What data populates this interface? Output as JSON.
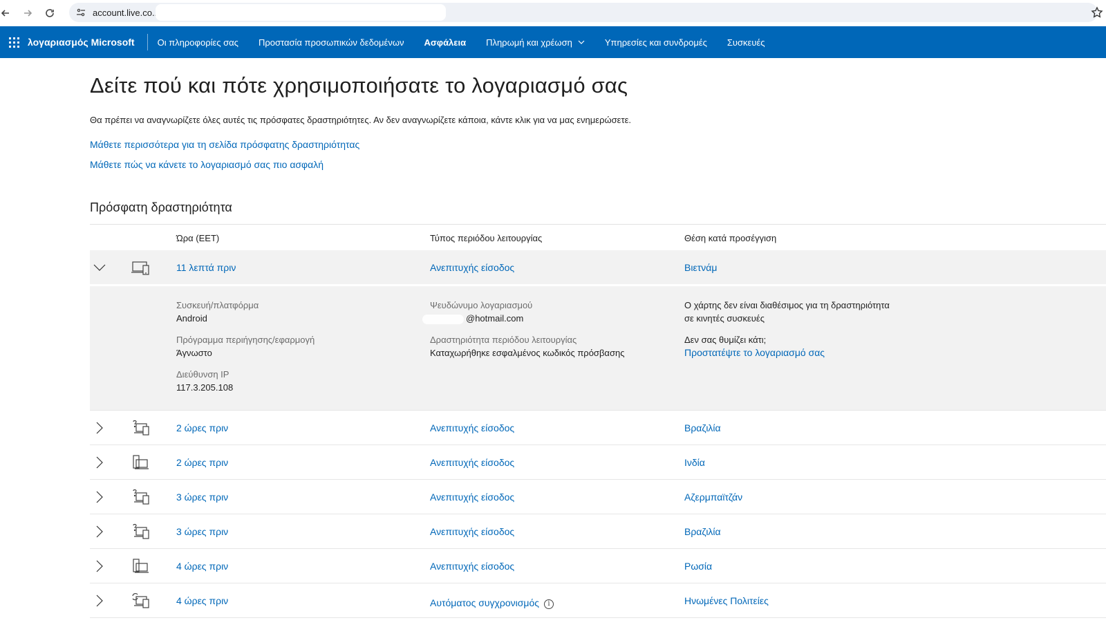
{
  "browser": {
    "url": "account.live.co.."
  },
  "nav": {
    "brand": "λογαριασμός Microsoft",
    "items": [
      {
        "label": "Οι πληροφορίες σας"
      },
      {
        "label": "Προστασία προσωπικών δεδομένων"
      },
      {
        "label": "Ασφάλεια",
        "active": true
      },
      {
        "label": "Πληρωμή και χρέωση",
        "dropdown": true
      },
      {
        "label": "Υπηρεσίες και συνδρομές"
      },
      {
        "label": "Συσκευές"
      }
    ],
    "color": "#0067b8"
  },
  "page": {
    "title": "Δείτε πού και πότε χρησιμοποιήσατε το λογαριασμό σας",
    "description": "Θα πρέπει να αναγνωρίζετε όλες αυτές τις πρόσφατες δραστηριότητες. Αν δεν αναγνωρίζετε κάποια, κάντε κλικ για να μας ενημερώσετε.",
    "link_learn_more": "Μάθετε περισσότερα για τη σελίδα πρόσφατης δραστηριότητας",
    "link_secure": "Μάθετε πώς να κάνετε το λογαριασμό σας πιο ασφαλή",
    "section_title": "Πρόσφατη δραστηριότητα"
  },
  "table": {
    "headers": {
      "time": "Ώρα (EET)",
      "type": "Τύπος περιόδου λειτουργίας",
      "location": "Θέση κατά προσέγγιση"
    },
    "expanded": {
      "time": "11 λεπτά πριν",
      "type": "Ανεπιτυχής είσοδος",
      "location": "Βιετνάμ",
      "device_icon": "laptop-phone-icon",
      "details": {
        "device_label": "Συσκευή/πλατφόρμα",
        "device_value": "Android",
        "browser_label": "Πρόγραμμα περιήγησης/εφαρμογή",
        "browser_value": "Άγνωστο",
        "ip_label": "Διεύθυνση IP",
        "ip_value": "117.3.205.108",
        "alias_label": "Ψευδώνυμο λογαριασμού",
        "alias_value": "@hotmail.com",
        "activity_label": "Δραστηριότητα περιόδου λειτουργίας",
        "activity_value": "Καταχωρήθηκε εσφαλμένος κωδικός πρόσβασης",
        "map_line1": "Ο χάρτης δεν είναι διαθέσιμος για τη δραστηριότητα",
        "map_line2": "σε κινητές συσκευές",
        "not_recognized": "Δεν σας θυμίζει κάτι;",
        "protect_link": "Προστατέψτε το λογαριασμό σας"
      }
    },
    "rows": [
      {
        "time": "2 ώρες πριν",
        "type": "Ανεπιτυχής είσοδος",
        "location": "Βραζιλία",
        "icon": "unknown-device-icon"
      },
      {
        "time": "2 ώρες πριν",
        "type": "Ανεπιτυχής είσοδος",
        "location": "Ινδία",
        "icon": "desktop-phone-icon"
      },
      {
        "time": "3 ώρες πριν",
        "type": "Ανεπιτυχής είσοδος",
        "location": "Αζερμπαϊτζάν",
        "icon": "unknown-device-icon"
      },
      {
        "time": "3 ώρες πριν",
        "type": "Ανεπιτυχής είσοδος",
        "location": "Βραζιλία",
        "icon": "unknown-device-icon"
      },
      {
        "time": "4 ώρες πριν",
        "type": "Ανεπιτυχής είσοδος",
        "location": "Ρωσία",
        "icon": "desktop-phone-icon"
      },
      {
        "time": "4 ώρες πριν",
        "type": "Αυτόματος συγχρονισμός",
        "location": "Ηνωμένες Πολιτείες",
        "icon": "sync-device-icon",
        "info": true
      }
    ]
  }
}
